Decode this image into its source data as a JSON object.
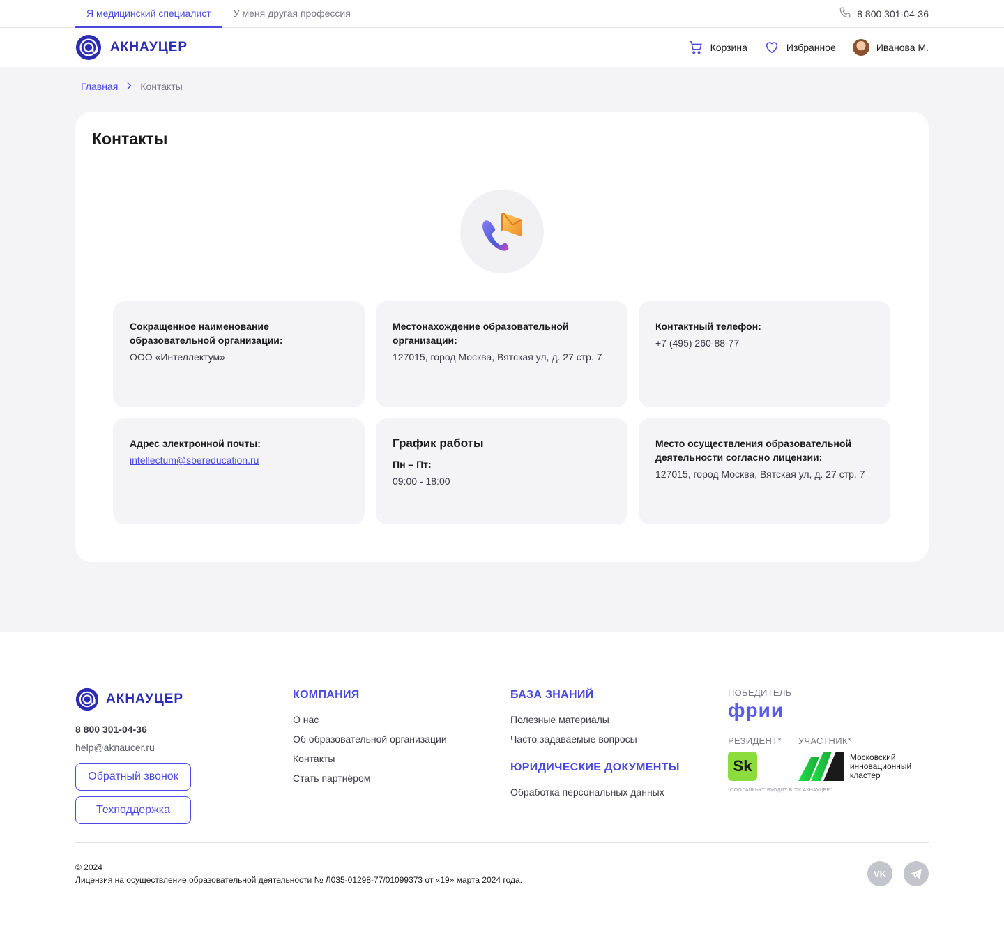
{
  "topbar": {
    "tabs": [
      "Я медицинский специалист",
      "У меня другая профессия"
    ],
    "phone": "8 800 301-04-36"
  },
  "header": {
    "logo_text": "АКНАУЦЕР",
    "cart": "Корзина",
    "favorites": "Избранное",
    "user": "Иванова М."
  },
  "breadcrumb": {
    "home": "Главная",
    "current": "Контакты"
  },
  "page": {
    "title": "Контакты"
  },
  "info": {
    "short_name_label": "Сокращенное наименование образовательной организации:",
    "short_name_value": "ООО «Интеллектум»",
    "location_label": "Местонахождение образовательной организации:",
    "location_value": "127015, город Москва, Вятская ул, д. 27 стр. 7",
    "phone_label": "Контактный телефон:",
    "phone_value": "+7 (495) 260-88-77",
    "email_label": "Адрес электронной почты:",
    "email_value": "intellectum@sbereducation.ru",
    "schedule_title": "График работы",
    "schedule_days": "Пн – Пт:",
    "schedule_hours": "09:00 - 18:00",
    "license_place_label": "Место осуществления образовательной деятельности согласно лицензии:",
    "license_place_value": "127015, город Москва, Вятская ул, д. 27 стр. 7"
  },
  "footer": {
    "logo_text": "АКНАУЦЕР",
    "phone": "8 800 301-04-36",
    "email": "help@aknaucer.ru",
    "callback_button": "Обратный звонок",
    "support_button": "Техподдержка",
    "company_head": "КОМПАНИЯ",
    "company_links": [
      "О нас",
      "Об образовательной организации",
      "Контакты",
      "Стать партнёром"
    ],
    "knowledge_head": "БАЗА ЗНАНИЙ",
    "knowledge_links": [
      "Полезные материалы",
      "Часто задаваемые вопросы"
    ],
    "legal_head": "ЮРИДИЧЕСКИЕ ДОКУМЕНТЫ",
    "legal_links": [
      "Обработка персональных данных"
    ],
    "winner_head": "ПОБЕДИТЕЛЬ",
    "frii": "фрии",
    "resident_head": "РЕЗИДЕНТ*",
    "participant_head": "УЧАСТНИК*",
    "sk": "Sk",
    "mic_text": "Московский инновационный кластер",
    "note": "*ООО \"АЙКЬЮ\" ВХОДИТ В \"ГК АКНАУЦЕР\"",
    "copyright": "© 2024",
    "license": "Лицензия на осуществление образовательной деятельности № Л035-01298-77/01099373 от «19» марта 2024 года.",
    "vk": "VK"
  },
  "colors": {
    "accent": "#4a4ae0",
    "brand": "#2b2bb5",
    "page_bg": "#f4f4f6"
  }
}
